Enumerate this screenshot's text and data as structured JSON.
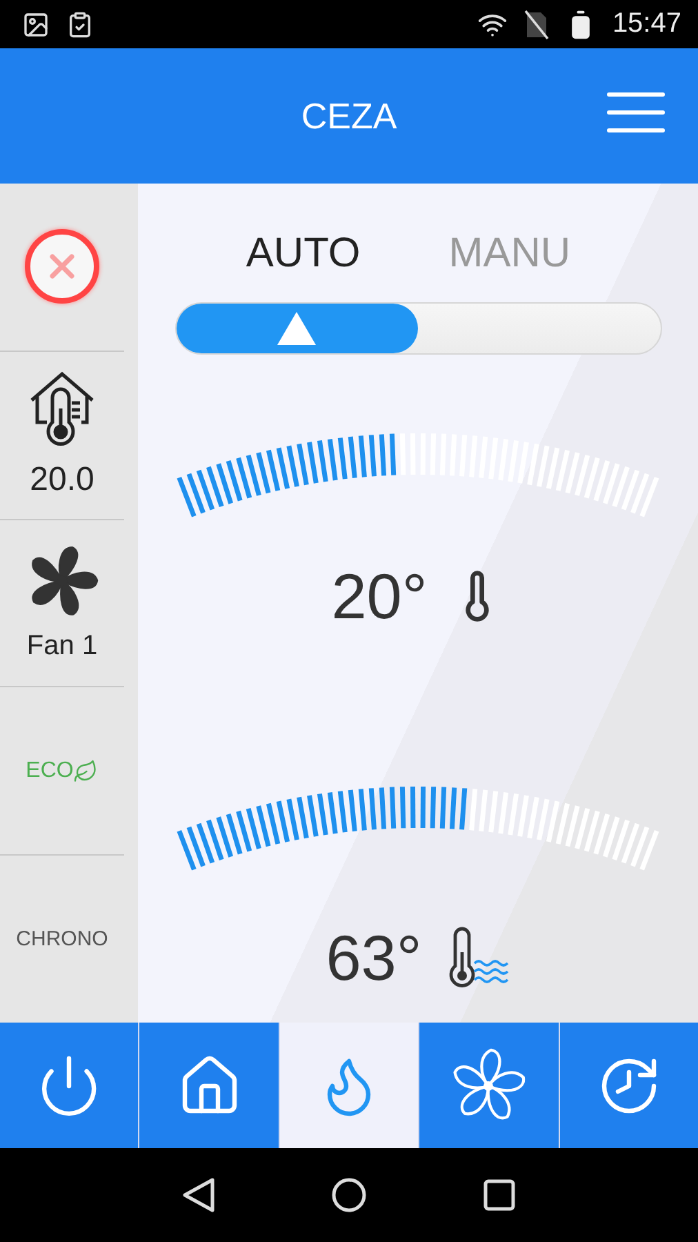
{
  "status_bar": {
    "time": "15:47"
  },
  "header": {
    "title": "CEZA"
  },
  "sidebar": [
    {
      "kind": "close"
    },
    {
      "kind": "room_temperature",
      "value": "20.0"
    },
    {
      "kind": "fan",
      "value": "Fan 1"
    },
    {
      "kind": "eco",
      "label": "ECO",
      "on": true
    },
    {
      "kind": "chrono",
      "label": "CHRONO",
      "on": false
    }
  ],
  "mode_tabs": [
    {
      "label": "AUTO",
      "selected": true
    },
    {
      "label": "MANU",
      "selected": false
    }
  ],
  "mode_slider": {
    "level": 0.5
  },
  "gauges": [
    {
      "kind": "room",
      "level": 0.46,
      "reading": "20°"
    },
    {
      "kind": "water",
      "level": 0.6,
      "reading": "63°"
    }
  ],
  "bottom_nav": [
    {
      "kind": "power",
      "selected": false
    },
    {
      "kind": "home",
      "selected": false
    },
    {
      "kind": "flame",
      "selected": true
    },
    {
      "kind": "fan",
      "selected": false
    },
    {
      "kind": "timer",
      "selected": false
    }
  ]
}
